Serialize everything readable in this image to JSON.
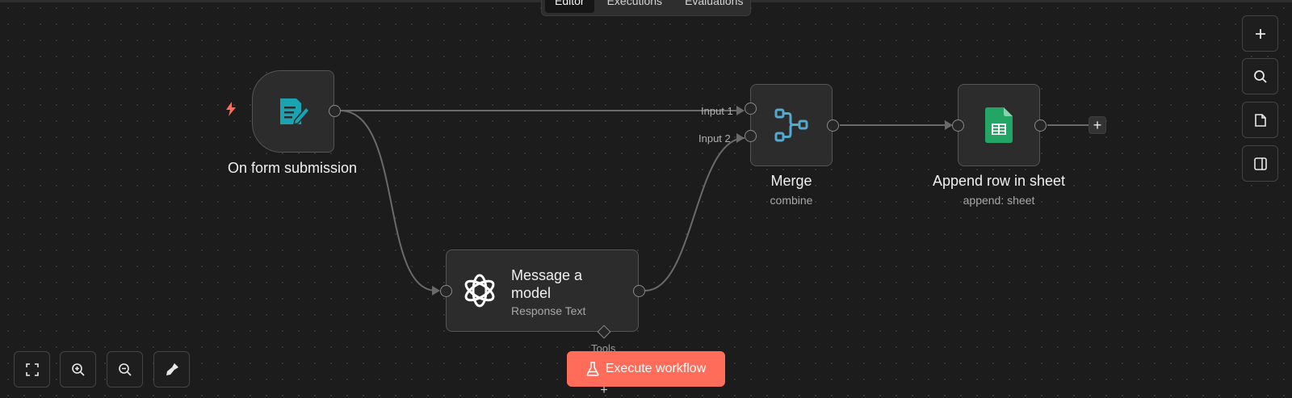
{
  "tabs": [
    {
      "label": "Editor",
      "active": true
    },
    {
      "label": "Executions",
      "active": false
    },
    {
      "label": "Evaluations",
      "active": false
    }
  ],
  "nodes": {
    "form_trigger": {
      "title": "On form submission",
      "icon": "form-icon"
    },
    "message_model": {
      "title_line1": "Message a",
      "title_line2": "model",
      "subtitle": "Response Text",
      "icon": "openai-icon",
      "tools_label": "Tools"
    },
    "merge": {
      "title": "Merge",
      "subtitle": "combine",
      "icon": "merge-icon",
      "input1": "Input 1",
      "input2": "Input 2"
    },
    "append_row": {
      "title": "Append row in sheet",
      "subtitle": "append: sheet",
      "icon": "google-sheets-icon"
    }
  },
  "execute_button": {
    "label": "Execute workflow",
    "icon": "flask-icon"
  },
  "side_toolbar": [
    "plus-icon",
    "search-icon",
    "sticky-note-icon",
    "panel-icon"
  ],
  "zoom_toolbar": [
    "fit-view-icon",
    "zoom-in-icon",
    "zoom-out-icon",
    "tidy-up-icon"
  ],
  "colors": {
    "canvas": "#1c1c1c",
    "accent": "#ff6d5a",
    "form_icon": "#1aa3b0",
    "merge_icon": "#54a9cf",
    "sheets_green": "#23a566",
    "trigger_bolt": "#ff6d5a"
  }
}
